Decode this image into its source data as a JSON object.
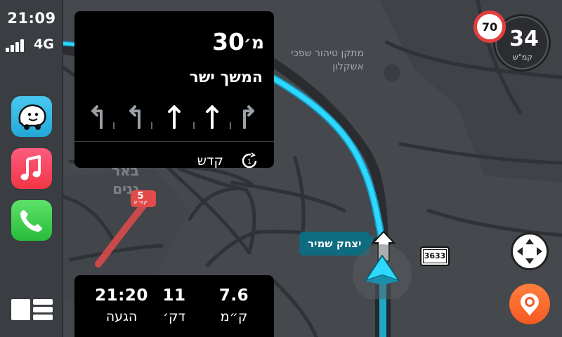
{
  "status": {
    "time": "21:09",
    "network": "4G",
    "signal_bars": 4
  },
  "sidebar": {
    "apps": [
      {
        "name": "Waze",
        "icon": "waze-icon"
      },
      {
        "name": "Music",
        "icon": "music-note-icon"
      },
      {
        "name": "Phone",
        "icon": "phone-icon"
      }
    ],
    "dashboard_icon": "dashboard-grid-icon"
  },
  "instruction": {
    "distance": "30",
    "distance_unit": "מ׳",
    "text": "המשך ישר",
    "lanes": [
      "turn-left",
      "turn-left",
      "straight",
      "straight",
      "turn-right"
    ],
    "active_lanes": [
      false,
      false,
      true,
      true,
      false
    ],
    "next_street": "קדש",
    "next_icon": "roundabout-exit-1-icon",
    "roundabout_exit": "1"
  },
  "eta": {
    "arrival_time": "21:20",
    "arrival_label": "הגעה",
    "minutes": "11",
    "minutes_label": "דק׳",
    "distance": "7.6",
    "distance_label": "ק״מ"
  },
  "speed": {
    "current": "34",
    "unit": "קמ\"ש",
    "limit": "70"
  },
  "map": {
    "poi_label": "מתקן טיהור שפכי אשקלון",
    "area_label": "באר גנים",
    "street_tag": "יצחק שמיר",
    "route_shield": "3633",
    "speed_badge": {
      "value": "5",
      "unit": "קמ״ש"
    },
    "route_color": "#2fd8ff",
    "background_color": "#45484d"
  }
}
